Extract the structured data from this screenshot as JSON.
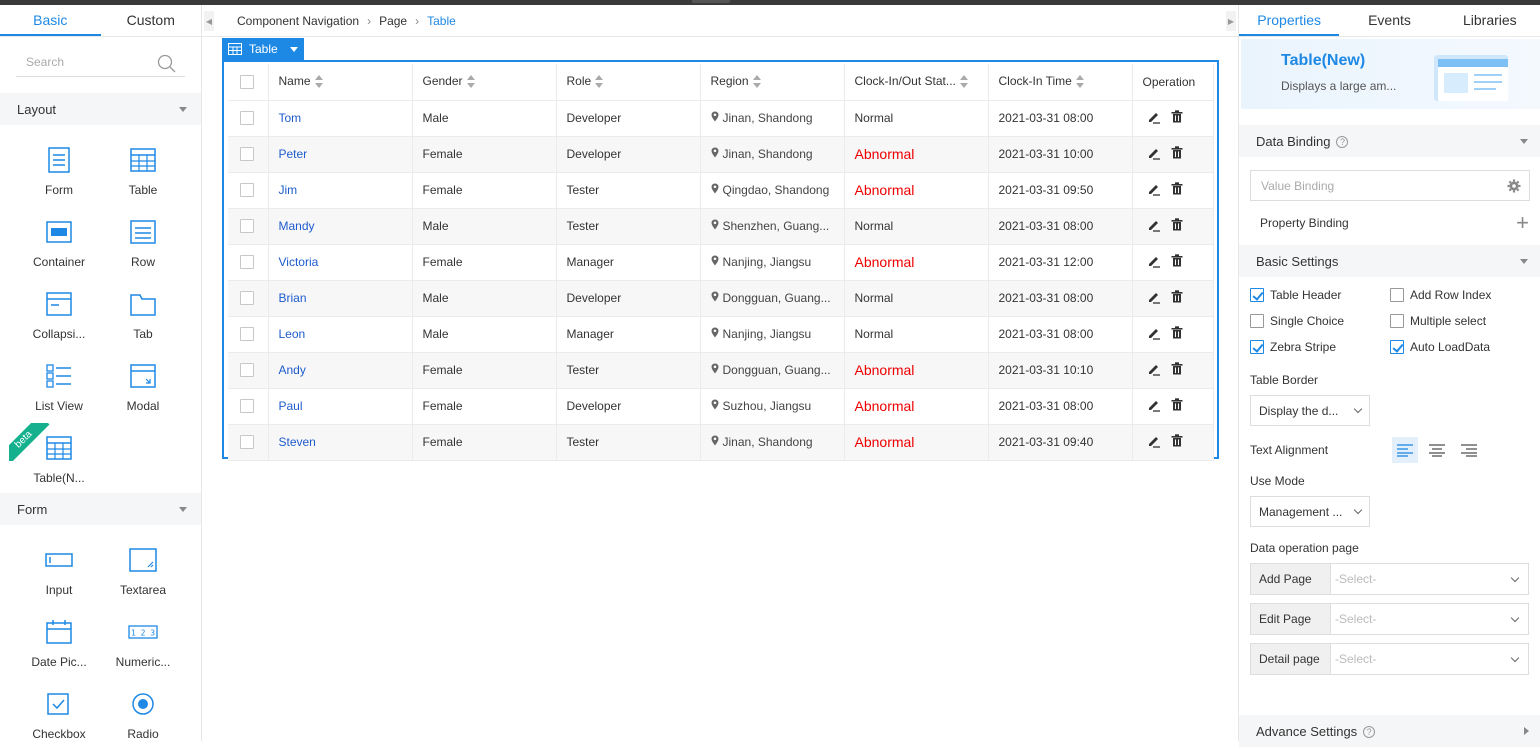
{
  "left": {
    "tabs": [
      "Basic",
      "Custom"
    ],
    "search_placeholder": "Search",
    "sections": [
      {
        "title": "Layout",
        "items": [
          "Form",
          "Table",
          "Container",
          "Row",
          "Collapsi...",
          "Tab",
          "List View",
          "Modal",
          "Table(N..."
        ]
      },
      {
        "title": "Form",
        "items": [
          "Input",
          "Textarea",
          "Date Pic...",
          "Numeric...",
          "Checkbox",
          "Radio"
        ]
      }
    ],
    "beta_badge": "beta"
  },
  "breadcrumb": [
    "Component Navigation",
    "Page",
    "Table"
  ],
  "table_tag": "Table",
  "table": {
    "headers": [
      "Name",
      "Gender",
      "Role",
      "Region",
      "Clock-In/Out Stat...",
      "Clock-In Time",
      "Operation"
    ],
    "rows": [
      [
        "Tom",
        "Male",
        "Developer",
        "Jinan, Shandong",
        "Normal",
        "2021-03-31 08:00"
      ],
      [
        "Peter",
        "Female",
        "Developer",
        "Jinan, Shandong",
        "Abnormal",
        "2021-03-31 10:00"
      ],
      [
        "Jim",
        "Female",
        "Tester",
        "Qingdao, Shandong",
        "Abnormal",
        "2021-03-31 09:50"
      ],
      [
        "Mandy",
        "Male",
        "Tester",
        "Shenzhen, Guang...",
        "Normal",
        "2021-03-31 08:00"
      ],
      [
        "Victoria",
        "Female",
        "Manager",
        "Nanjing, Jiangsu",
        "Abnormal",
        "2021-03-31 12:00"
      ],
      [
        "Brian",
        "Male",
        "Developer",
        "Dongguan, Guang...",
        "Normal",
        "2021-03-31 08:00"
      ],
      [
        "Leon",
        "Male",
        "Manager",
        "Nanjing, Jiangsu",
        "Normal",
        "2021-03-31 08:00"
      ],
      [
        "Andy",
        "Female",
        "Tester",
        "Dongguan, Guang...",
        "Abnormal",
        "2021-03-31 10:10"
      ],
      [
        "Paul",
        "Female",
        "Developer",
        "Suzhou, Jiangsu",
        "Abnormal",
        "2021-03-31 08:00"
      ],
      [
        "Steven",
        "Female",
        "Tester",
        "Jinan, Shandong",
        "Abnormal",
        "2021-03-31 09:40"
      ]
    ]
  },
  "right": {
    "tabs": [
      "Properties",
      "Events",
      "Libraries"
    ],
    "hero_title": "Table(New)",
    "hero_desc": "Displays a large am...",
    "data_binding": "Data Binding",
    "value_binding_placeholder": "Value Binding",
    "property_binding": "Property Binding",
    "basic_settings": "Basic Settings",
    "checks": [
      {
        "label": "Table Header",
        "checked": true
      },
      {
        "label": "Add Row Index",
        "checked": false
      },
      {
        "label": "Single Choice",
        "checked": false
      },
      {
        "label": "Multiple select",
        "checked": false
      },
      {
        "label": "Zebra Stripe",
        "checked": true
      },
      {
        "label": "Auto LoadData",
        "checked": true
      }
    ],
    "table_border_label": "Table Border",
    "table_border_value": "Display the d...",
    "text_alignment_label": "Text Alignment",
    "use_mode_label": "Use Mode",
    "use_mode_value": "Management ...",
    "data_op_label": "Data operation page",
    "data_op": [
      {
        "label": "Add Page",
        "value": "-Select-"
      },
      {
        "label": "Edit Page",
        "value": "-Select-"
      },
      {
        "label": "Detail page",
        "value": "-Select-"
      }
    ],
    "advance_settings": "Advance Settings"
  },
  "colors": {
    "accent": "#1e88e5",
    "abnormal": "#e00000",
    "beta": "#15b18f"
  }
}
